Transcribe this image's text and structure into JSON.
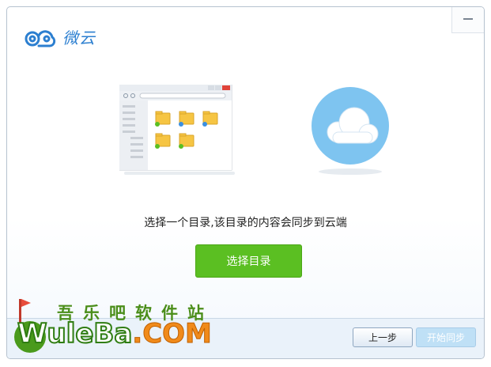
{
  "app": {
    "name": "微云",
    "minimize_label": "—"
  },
  "main": {
    "prompt": "选择一个目录,该目录的内容会同步到云端",
    "choose_button": "选择目录"
  },
  "footer": {
    "prev_button": "上一步",
    "start_button": "开始同步"
  },
  "watermark": {
    "cn": "吾乐吧软件站",
    "en_main": "WuleBa",
    "en_suffix": ".COM"
  },
  "colors": {
    "accent_green": "#5bbf22",
    "brand_blue": "#2c7fd0",
    "cloud_circle": "#7ec4f0"
  }
}
